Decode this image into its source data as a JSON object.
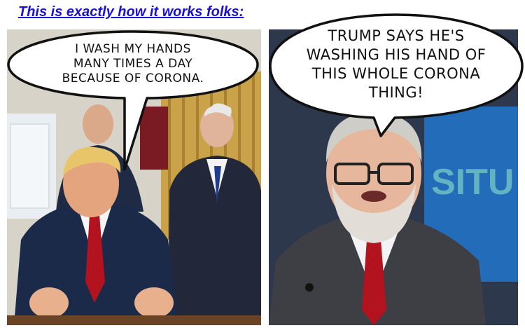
{
  "header": {
    "text": "This is exactly how it works folks:"
  },
  "left_panel": {
    "bubble_text": "I WASH MY HANDS\nMANY TIMES A DAY\nBECAUSE OF CORONA."
  },
  "right_panel": {
    "bubble_text": "TRUMP SAYS HE'S\nWASHING HIS HAND OF\nTHIS WHOLE CORONA\nTHING!",
    "screen_text": "SITU"
  },
  "colors": {
    "header": "#1a10d6",
    "tie_red": "#b3121f",
    "curtain_gold": "#c9a24a"
  }
}
